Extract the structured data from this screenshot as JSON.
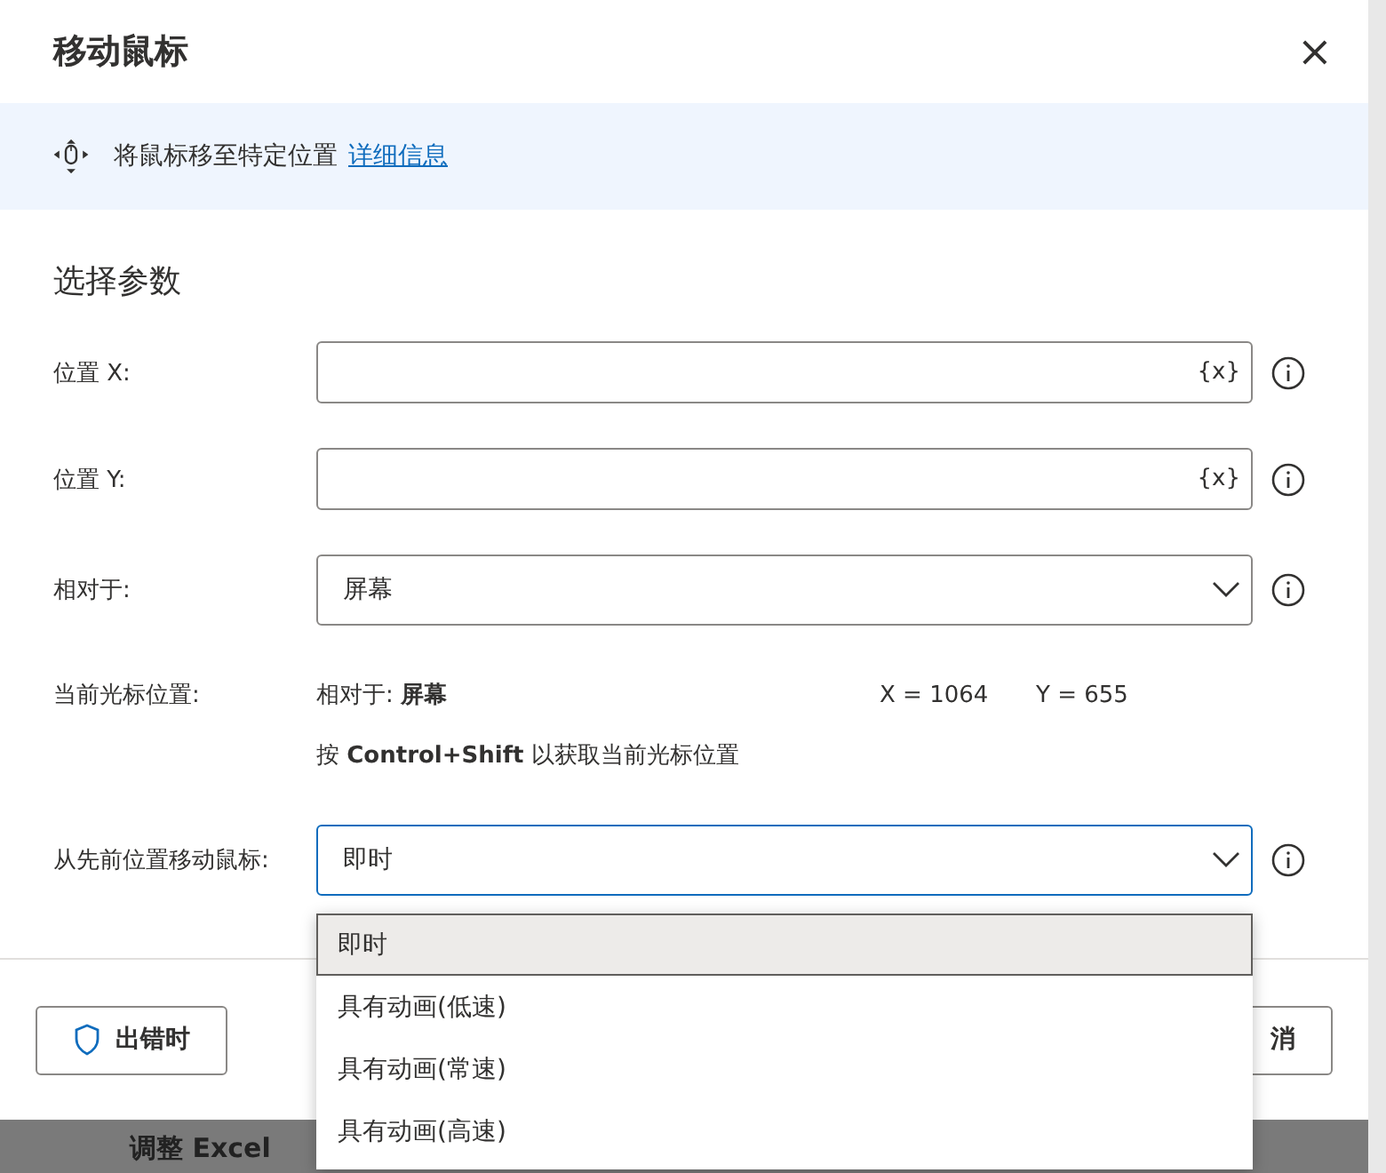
{
  "dialog": {
    "title": "移动鼠标",
    "close": "×"
  },
  "banner": {
    "text": "将鼠标移至特定位置",
    "link": "详细信息"
  },
  "section_title": "选择参数",
  "fields": [
    {
      "kind": "text",
      "label": "位置 X:",
      "var_button": "{x}"
    },
    {
      "kind": "text",
      "label": "位置 Y:",
      "var_button": "{x}"
    },
    {
      "kind": "select",
      "label": "相对于:",
      "value": "屏幕",
      "focused": false
    }
  ],
  "cursor": {
    "label": "当前光标位置:",
    "relative": "相对于: **屏幕**",
    "x": "X = 1064",
    "y": "Y = 655",
    "hint": "按 **Control+Shift** 以获取当前光标位置"
  },
  "move_field": {
    "label": "从先前位置移动鼠标:",
    "value": "即时",
    "focused": true,
    "expanded": true,
    "options": [
      {
        "label": "即时",
        "selected": true
      },
      {
        "label": "具有动画(低速)",
        "selected": false
      },
      {
        "label": "具有动画(常速)",
        "selected": false
      },
      {
        "label": "具有动画(高速)",
        "selected": false
      }
    ]
  },
  "footer": {
    "on_error": "出错时",
    "cancel": "消"
  },
  "background_text": "调整 Excel"
}
